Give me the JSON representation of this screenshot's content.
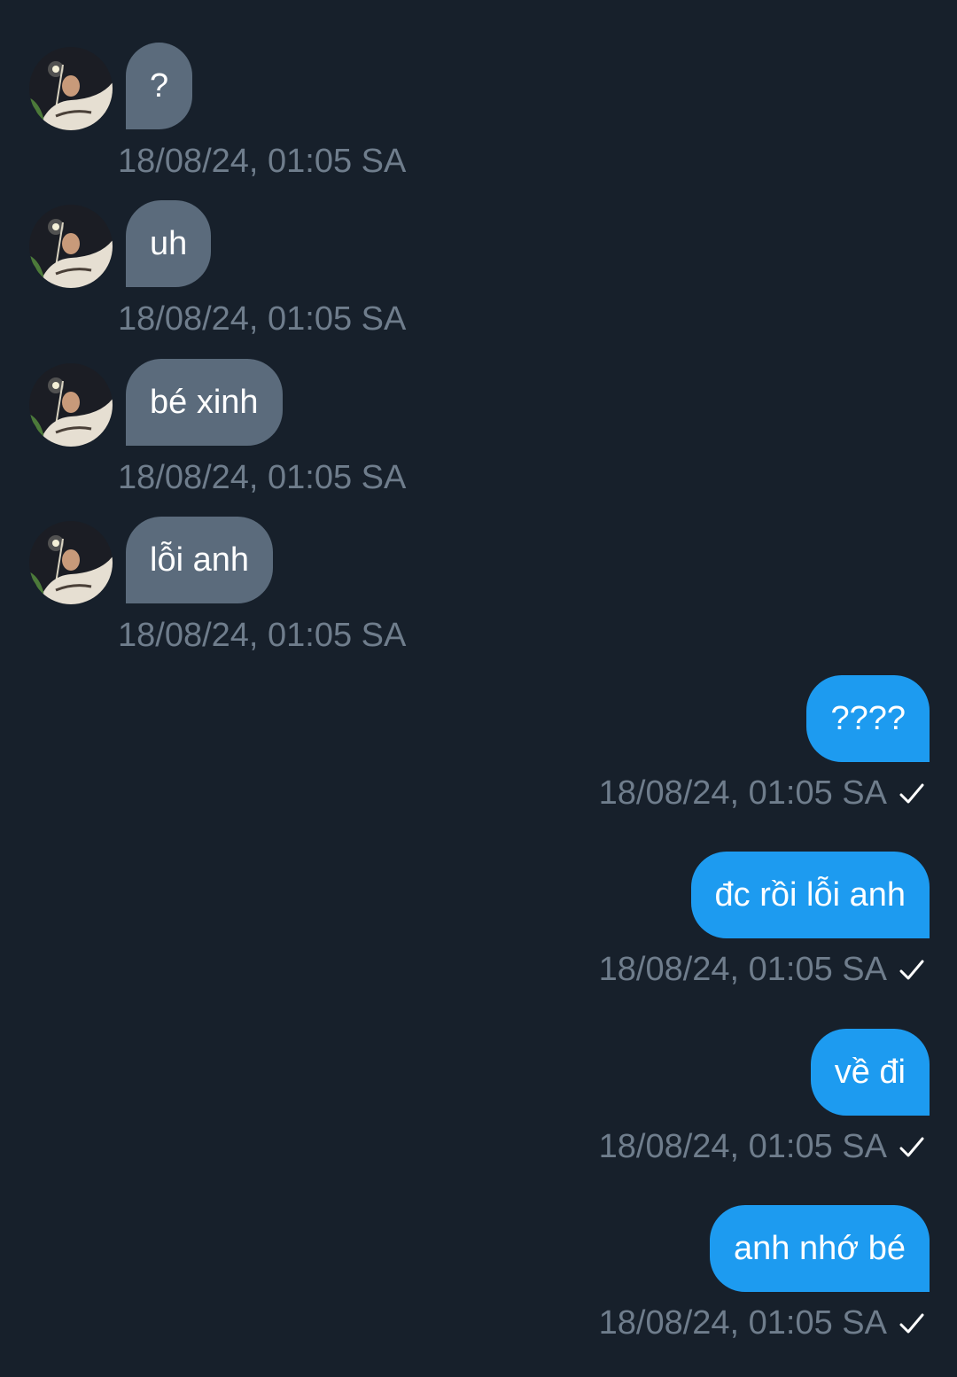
{
  "conversation": {
    "incoming": [
      {
        "text": "?",
        "timestamp": "18/08/24, 01:05 SA"
      },
      {
        "text": "uh",
        "timestamp": "18/08/24, 01:05 SA"
      },
      {
        "text": "bé xinh",
        "timestamp": "18/08/24, 01:05 SA"
      },
      {
        "text": "lỗi anh",
        "timestamp": "18/08/24, 01:05 SA"
      }
    ],
    "outgoing": [
      {
        "text": "????",
        "timestamp": "18/08/24, 01:05 SA",
        "status_icon": "check-icon"
      },
      {
        "text": "đc rồi lỗi anh",
        "timestamp": "18/08/24, 01:05 SA",
        "status_icon": "check-icon"
      },
      {
        "text": "về đi",
        "timestamp": "18/08/24, 01:05 SA",
        "status_icon": "check-icon"
      },
      {
        "text": "anh nhớ bé",
        "timestamp": "18/08/24, 01:05 SA",
        "status_icon": "check-icon"
      }
    ]
  },
  "colors": {
    "background": "#17202b",
    "incoming_bubble": "#5b6b7c",
    "outgoing_bubble": "#1d9bf0",
    "timestamp_text": "#6f7d8c"
  }
}
